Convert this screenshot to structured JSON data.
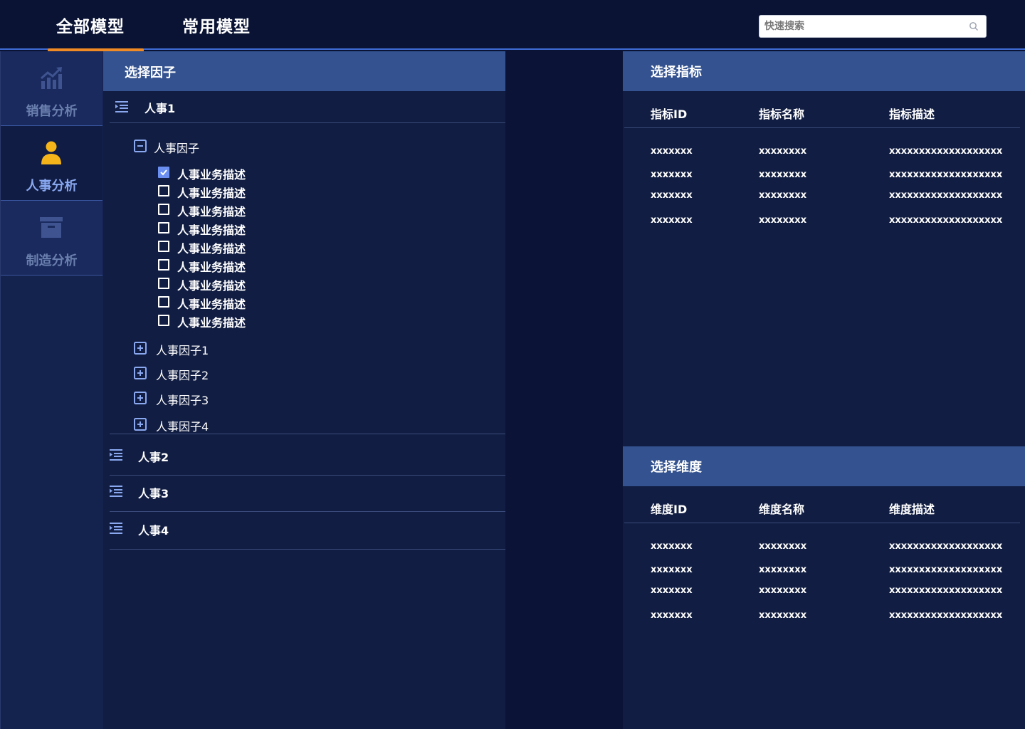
{
  "top_tabs": [
    "全部模型",
    "常用模型"
  ],
  "search": {
    "placeholder": "快速搜索",
    "value": ""
  },
  "sidebar": {
    "items": [
      {
        "label": "销售分析",
        "icon": "chart-growth-icon"
      },
      {
        "label": "人事分析",
        "icon": "user-icon"
      },
      {
        "label": "制造分析",
        "icon": "archive-box-icon"
      }
    ]
  },
  "factor_panel": {
    "title": "选择因子",
    "groups": [
      {
        "label": "人事1",
        "expanded": true
      },
      {
        "label": "人事2",
        "expanded": false
      },
      {
        "label": "人事3",
        "expanded": false
      },
      {
        "label": "人事4",
        "expanded": false
      }
    ],
    "subgroup_expanded": {
      "label": "人事因子"
    },
    "leaves": [
      {
        "label": "人事业务描述",
        "checked": true
      },
      {
        "label": "人事业务描述",
        "checked": false
      },
      {
        "label": "人事业务描述",
        "checked": false
      },
      {
        "label": "人事业务描述",
        "checked": false
      },
      {
        "label": "人事业务描述",
        "checked": false
      },
      {
        "label": "人事业务描述",
        "checked": false
      },
      {
        "label": "人事业务描述",
        "checked": false
      },
      {
        "label": "人事业务描述",
        "checked": false
      },
      {
        "label": "人事业务描述",
        "checked": false
      }
    ],
    "subgroups_collapsed": [
      "人事因子1",
      "人事因子2",
      "人事因子3",
      "人事因子4"
    ]
  },
  "indicator_panel": {
    "title": "选择指标",
    "columns": [
      "指标ID",
      "指标名称",
      "指标描述"
    ],
    "rows": [
      [
        "xxxxxxx",
        "xxxxxxxx",
        "xxxxxxxxxxxxxxxxxxx"
      ],
      [
        "xxxxxxx",
        "xxxxxxxx",
        "xxxxxxxxxxxxxxxxxxx"
      ],
      [
        "xxxxxxx",
        "xxxxxxxx",
        "xxxxxxxxxxxxxxxxxxx"
      ],
      [
        "xxxxxxx",
        "xxxxxxxx",
        "xxxxxxxxxxxxxxxxxxx"
      ]
    ]
  },
  "dimension_panel": {
    "title": "选择维度",
    "columns": [
      "维度ID",
      "维度名称",
      "维度描述"
    ],
    "rows": [
      [
        "xxxxxxx",
        "xxxxxxxx",
        "xxxxxxxxxxxxxxxxxxx"
      ],
      [
        "xxxxxxx",
        "xxxxxxxx",
        "xxxxxxxxxxxxxxxxxxx"
      ],
      [
        "xxxxxxx",
        "xxxxxxxx",
        "xxxxxxxxxxxxxxxxxxx"
      ],
      [
        "xxxxxxx",
        "xxxxxxxx",
        "xxxxxxxxxxxxxxxxxxx"
      ]
    ]
  },
  "colors": {
    "background": "#0a1334",
    "panel": "#111d42",
    "header_band": "#33528f",
    "accent_orange": "#f08a24",
    "accent_blue": "#3f6bd4",
    "user_icon_gold": "#f5b51a",
    "checkbox_checked": "#6b8ff0"
  }
}
